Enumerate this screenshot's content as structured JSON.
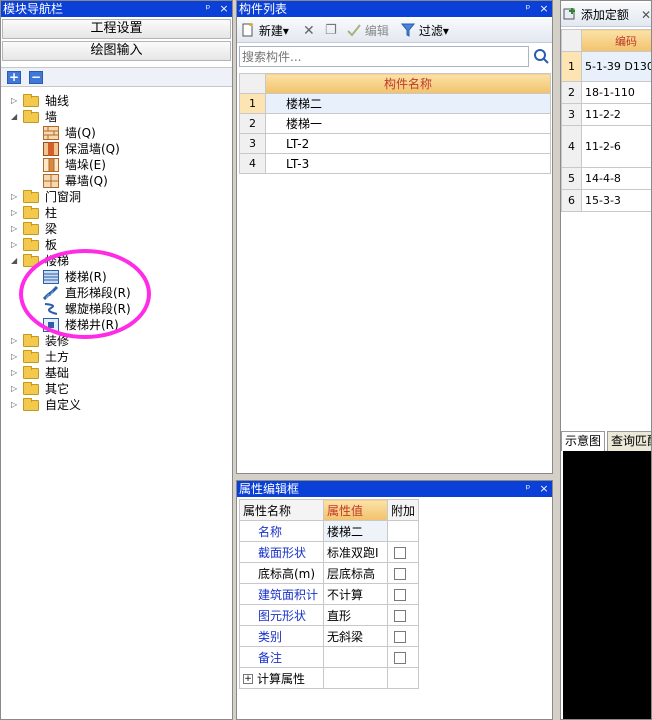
{
  "nav": {
    "title": "模块导航栏",
    "pin_glyph": "ᵖ",
    "close_glyph": "×",
    "project_settings": "工程设置",
    "drawing_input": "绘图输入",
    "add_glyph": "+",
    "remove_glyph": "−",
    "tree": [
      {
        "label": "轴线",
        "expander": "▷"
      },
      {
        "label": "墙",
        "expander": "◢"
      },
      {
        "label": "墙(Q)"
      },
      {
        "label": "保温墙(Q)"
      },
      {
        "label": "墙垛(E)"
      },
      {
        "label": "幕墙(Q)"
      },
      {
        "label": "门窗洞",
        "expander": "▷"
      },
      {
        "label": "柱",
        "expander": "▷"
      },
      {
        "label": "梁",
        "expander": "▷"
      },
      {
        "label": "板",
        "expander": "▷"
      },
      {
        "label": "楼梯",
        "expander": "◢"
      },
      {
        "label": "楼梯(R)"
      },
      {
        "label": "直形梯段(R)"
      },
      {
        "label": "螺旋梯段(R)"
      },
      {
        "label": "楼梯井(R)"
      },
      {
        "label": "装修",
        "expander": "▷"
      },
      {
        "label": "土方",
        "expander": "▷"
      },
      {
        "label": "基础",
        "expander": "▷"
      },
      {
        "label": "其它",
        "expander": "▷"
      },
      {
        "label": "自定义",
        "expander": "▷"
      }
    ]
  },
  "component_list": {
    "title": "构件列表",
    "pin_glyph": "ᵖ",
    "close_glyph": "×",
    "toolbar": {
      "new_label": "新建",
      "new_arrow": "▾",
      "delete_glyph": "✕",
      "copy_glyph": "❐",
      "edit_label": "编辑",
      "filter_label": "过滤",
      "filter_arrow": "▾"
    },
    "search_placeholder": "搜索构件...",
    "column_header": "构件名称",
    "rows": [
      {
        "no": "1",
        "name": "楼梯二"
      },
      {
        "no": "2",
        "name": "楼梯一"
      },
      {
        "no": "3",
        "name": "LT-2"
      },
      {
        "no": "4",
        "name": "LT-3"
      }
    ]
  },
  "property_editor": {
    "title": "属性编辑框",
    "pin_glyph": "ᵖ",
    "close_glyph": "×",
    "headers": {
      "name": "属性名称",
      "value": "属性值",
      "extra": "附加"
    },
    "rows": [
      {
        "name": "名称",
        "value": "楼梯二",
        "checkbox": false
      },
      {
        "name": "截面形状",
        "value": "标准双跑I",
        "checkbox": true
      },
      {
        "name": "底标高(m)",
        "value": "层底标高",
        "checkbox": true
      },
      {
        "name": "建筑面积计",
        "value": "不计算",
        "checkbox": true
      },
      {
        "name": "图元形状",
        "value": "直形",
        "checkbox": true
      },
      {
        "name": "类别",
        "value": "无斜梁",
        "checkbox": true
      },
      {
        "name": "备注",
        "value": "",
        "checkbox": true
      }
    ],
    "calc_group": "计算属性",
    "calc_expander": "+"
  },
  "right_panel": {
    "add_quota": "添加定额",
    "close_glyph": "✕",
    "header_code": "编码",
    "rows": [
      {
        "no": "1",
        "code": "5-1-39 D130"
      },
      {
        "no": "2",
        "code": "18-1-110"
      },
      {
        "no": "3",
        "code": "11-2-2"
      },
      {
        "no": "4",
        "code": "11-2-6"
      },
      {
        "no": "5",
        "code": "14-4-8"
      },
      {
        "no": "6",
        "code": "15-3-3"
      }
    ],
    "tabs": [
      "示意图",
      "查询匹配"
    ]
  },
  "colors": {
    "title_bar": "#0a3fd8",
    "header_gold": "#f2c26b",
    "highlight_circle": "#ff2be6"
  }
}
